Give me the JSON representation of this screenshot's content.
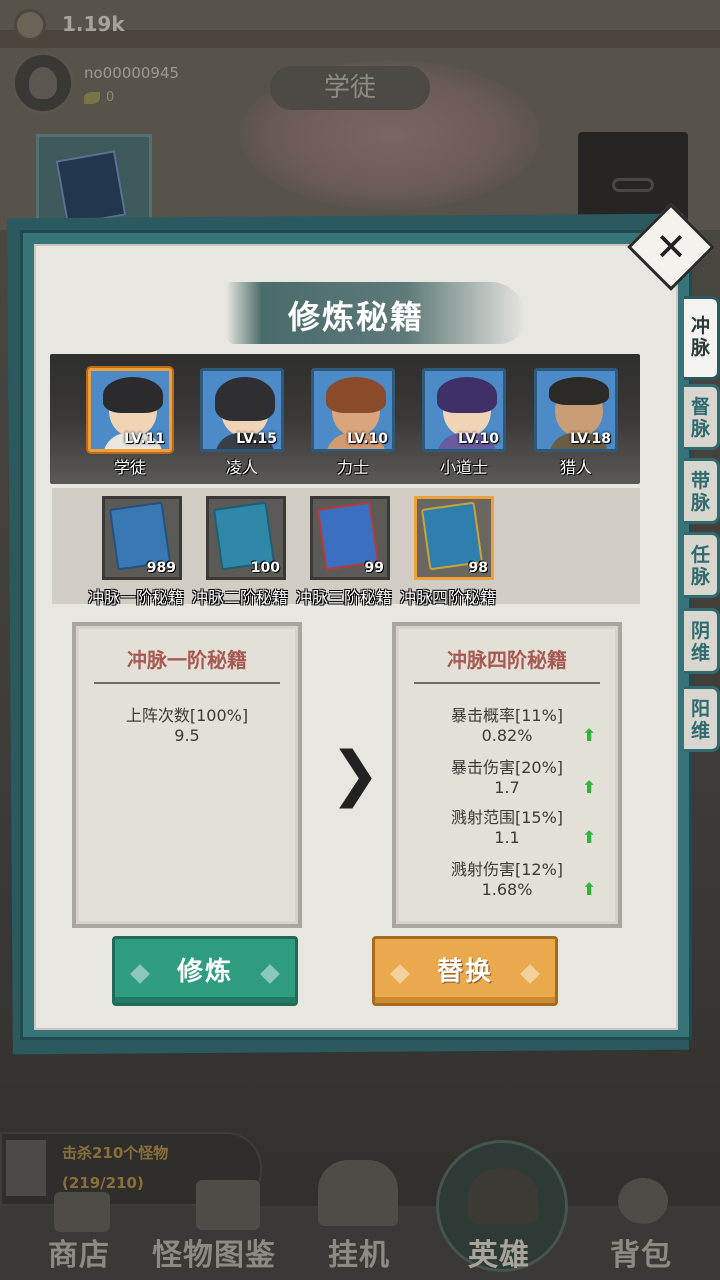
{
  "topbar": {
    "coins": "1.19k",
    "player_id": "no00000945",
    "player_stat": "0",
    "hero_tag": "学徒"
  },
  "dialog": {
    "title": "修炼秘籍",
    "close_label": "✕",
    "side_tabs": [
      "冲脉",
      "督脉",
      "带脉",
      "任脉",
      "阴维",
      "阳维"
    ],
    "heroes": [
      {
        "name": "学徒",
        "level": "LV.11",
        "selected": true
      },
      {
        "name": "凌人",
        "level": "LV.15",
        "selected": false
      },
      {
        "name": "力士",
        "level": "LV.10",
        "selected": false
      },
      {
        "name": "小道士",
        "level": "LV.10",
        "selected": false
      },
      {
        "name": "猎人",
        "level": "LV.18",
        "selected": false
      }
    ],
    "books": [
      {
        "name": "冲脉一阶秘籍",
        "count": "989",
        "selected": false
      },
      {
        "name": "冲脉二阶秘籍",
        "count": "100",
        "selected": false
      },
      {
        "name": "冲脉三阶秘籍",
        "count": "99",
        "selected": false
      },
      {
        "name": "冲脉四阶秘籍",
        "count": "98",
        "selected": true
      }
    ],
    "current": {
      "title": "冲脉一阶秘籍",
      "stats": [
        {
          "label": "上阵次数[100%]",
          "value": "9.5"
        }
      ]
    },
    "next": {
      "title": "冲脉四阶秘籍",
      "stats": [
        {
          "label": "暴击概率[11%]",
          "value": "0.82%"
        },
        {
          "label": "暴击伤害[20%]",
          "value": "1.7"
        },
        {
          "label": "溅射范围[15%]",
          "value": "1.1"
        },
        {
          "label": "溅射伤害[12%]",
          "value": "1.68%"
        }
      ]
    },
    "arrow_glyph": "❯",
    "up_glyph": "⬆",
    "train_button": "修炼",
    "replace_button": "替换"
  },
  "quest": {
    "title": "击杀210个怪物",
    "progress": "(219/210)"
  },
  "nav": [
    "商店",
    "怪物图鉴",
    "挂机",
    "英雄",
    "背包"
  ],
  "colors": {
    "accent_teal": "#377479",
    "train_green": "#2f9b7f",
    "replace_orange": "#e9a94c",
    "panel_title_red": "#a85a52",
    "selected_border": "#f0a03a",
    "up_arrow_green": "#33b33b"
  }
}
